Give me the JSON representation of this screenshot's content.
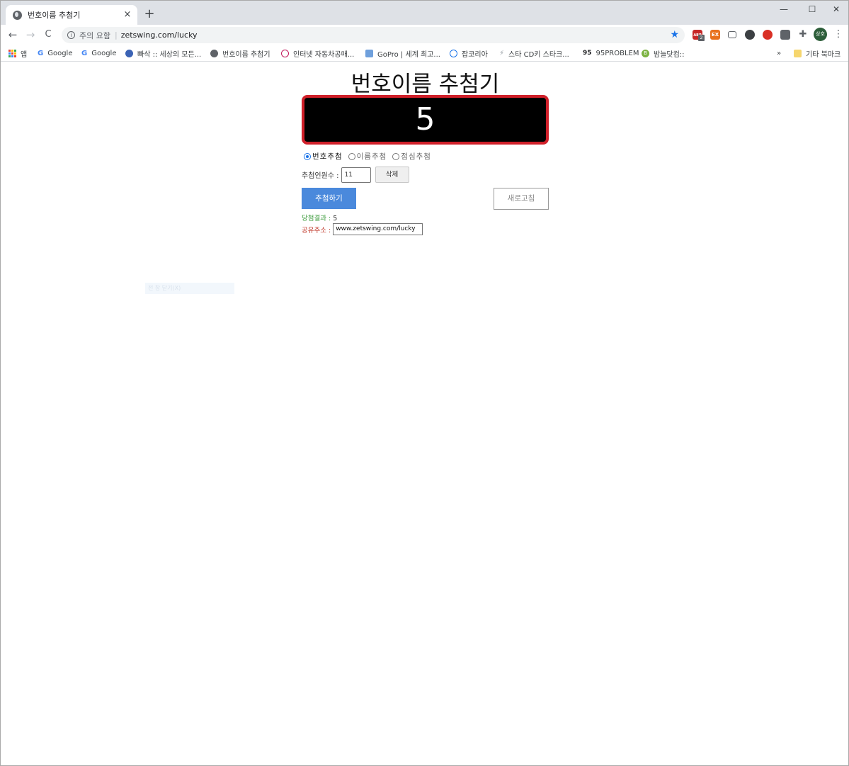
{
  "browser": {
    "tab_title": "번호이름 추첨기",
    "tab_close": "×",
    "new_tab": "+",
    "win_min": "—",
    "win_max": "☐",
    "win_close": "✕",
    "nav_back": "←",
    "nav_forward": "→",
    "nav_reload": "C",
    "security_text": "주의 요함",
    "url_sep": "|",
    "url": "zetswing.com/lucky",
    "avatar_text": "상호",
    "ext_abp": "ABP",
    "ext_abp_badge": "2",
    "ext_ex": "EX",
    "bookmarks": [
      "앱",
      "Google",
      "Google",
      "빠삭 :: 세상의 모든...",
      "번호이름 추첨기",
      "인터넷 자동차공매...",
      "GoPro | 세계 최고...",
      "잡코리아",
      "스타 CD키 스타크...",
      "95PROBLEM",
      "밤늘닷컴::"
    ],
    "bookmarks_more": "»",
    "other_bookmarks": "기타 북마크",
    "bm_95_logo": "95",
    "bm_b_logo": "B"
  },
  "page": {
    "title": "번호이름 추첨기",
    "display_value": "5",
    "radio_options": [
      "번호추첨",
      "이름추첨",
      "점심추첨"
    ],
    "selected_radio": "번호추첨",
    "count_label": "추첨인원수 :",
    "count_value": "11",
    "delete_label": "삭제",
    "draw_label": "추첨하기",
    "refresh_label": "새로고침",
    "result_label": "당첨결과 :",
    "result_value": "5",
    "share_label": "공유주소 :",
    "share_value": "www.zetswing.com/lucky",
    "ghost_text": "전 창 닫기(X)"
  },
  "colors": {
    "display_border": "#d0202a",
    "draw_button": "#4a89dc",
    "result_label": "#3a9a3a",
    "share_label": "#c0392b",
    "star": "#1a73e8"
  },
  "icons": [
    "globe-icon",
    "close-icon",
    "plus-icon",
    "back-icon",
    "forward-icon",
    "reload-icon",
    "info-icon",
    "star-icon",
    "puzzle-icon",
    "kebab-menu-icon",
    "apps-grid-icon"
  ]
}
